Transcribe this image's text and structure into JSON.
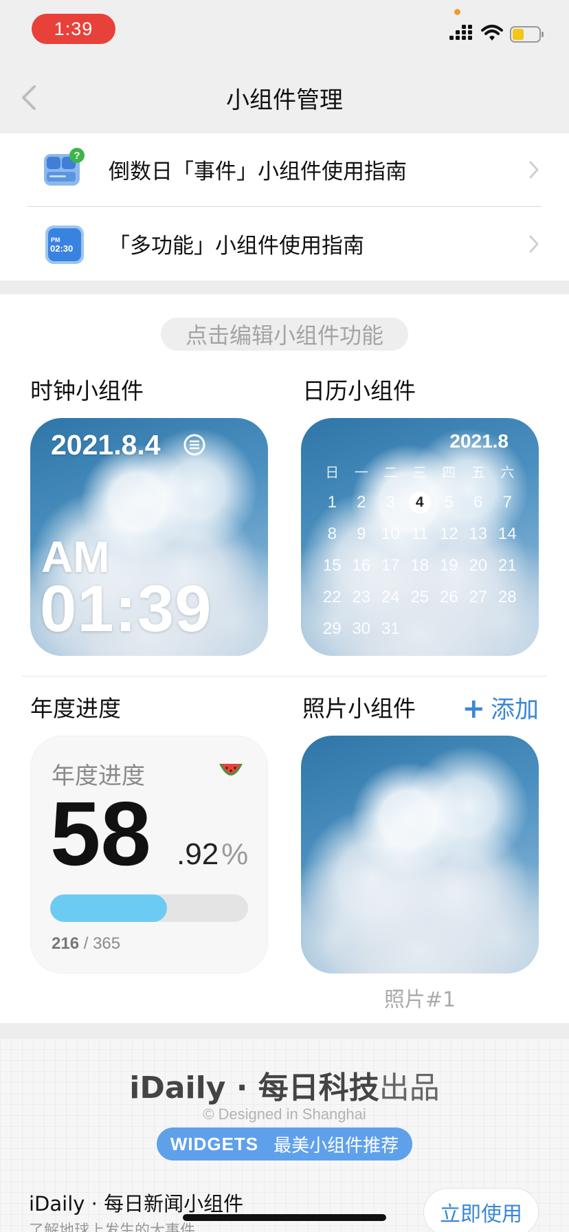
{
  "status_bar": {
    "time": "1:39",
    "colors": {
      "time_pill": "#e8413a",
      "dot": "#f39a2b",
      "battery": "#f5c518"
    },
    "icons": [
      "signal-icon",
      "wifi-icon",
      "battery-icon"
    ]
  },
  "nav": {
    "title": "小组件管理",
    "back_icon": "chevron-left-icon"
  },
  "guides": [
    {
      "label": "倒数日「事件」小组件使用指南",
      "icon": "widget-help-icon"
    },
    {
      "label": "「多功能」小组件使用指南",
      "icon": "widget-clock-icon",
      "icon_text_top": "PM",
      "icon_text_bottom": "02:30"
    }
  ],
  "main": {
    "edit_hint": "点击编辑小组件功能",
    "clock": {
      "title": "时钟小组件",
      "date": "2021.8.4",
      "ampm": "AM",
      "time": "01:39"
    },
    "calendar": {
      "title": "日历小组件",
      "month": "2021.8",
      "weekdays": [
        "日",
        "一",
        "二",
        "三",
        "四",
        "五",
        "六"
      ],
      "weeks": [
        [
          "1",
          "2",
          "3",
          "4",
          "5",
          "6",
          "7"
        ],
        [
          "8",
          "9",
          "10",
          "11",
          "12",
          "13",
          "14"
        ],
        [
          "15",
          "16",
          "17",
          "18",
          "19",
          "20",
          "21"
        ],
        [
          "22",
          "23",
          "24",
          "25",
          "26",
          "27",
          "28"
        ],
        [
          "29",
          "30",
          "31",
          "",
          "",
          "",
          ""
        ]
      ],
      "today": "4"
    },
    "year_progress": {
      "title": "年度进度",
      "card_label": "年度进度",
      "percent_int": "58",
      "percent_dec": ".92",
      "percent_sign": "%",
      "progress": 0.5892,
      "day": "216",
      "separator": " / ",
      "total": "365",
      "bar_color": "#6ccbf2"
    },
    "photo": {
      "title": "照片小组件",
      "add_plus": "+",
      "add_label": "添加",
      "caption": "照片#1"
    }
  },
  "footer": {
    "brand_bold": "iDaily · 每日科技",
    "brand_light": "出品",
    "designed": "© Designed in Shanghai",
    "widgets_en": "WIDGETS",
    "widgets_cn": "最美小组件推荐",
    "promo_title": "iDaily · 每日新闻小组件",
    "promo_sub": "了解地球上发生的大事件",
    "use_button": "立即使用"
  }
}
